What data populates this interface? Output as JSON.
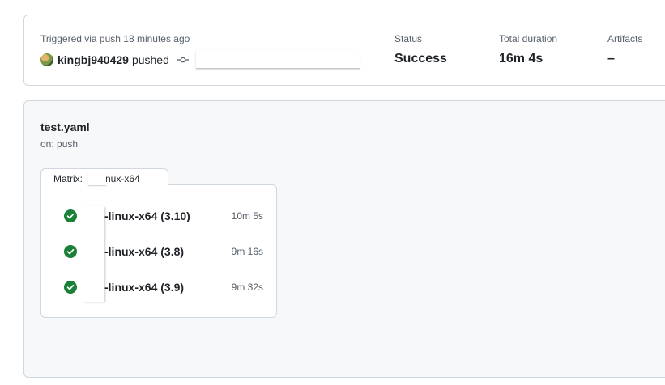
{
  "summary": {
    "trigger_text": "Triggered via push 18 minutes ago",
    "actor": "kingbj940429",
    "action": "pushed",
    "commit_sha": "",
    "status_label": "Status",
    "status_value": "Success",
    "duration_label": "Total duration",
    "duration_value": "16m 4s",
    "artifacts_label": "Artifacts",
    "artifacts_value": "–"
  },
  "workflow": {
    "name": "test.yaml",
    "trigger": "on: push",
    "matrix_label": "Matrix: ",
    "matrix_name_visible": "t-linux-x64",
    "jobs": [
      {
        "name": "-linux-x64 (3.10)",
        "duration": "10m 5s",
        "status": "success"
      },
      {
        "name": "-linux-x64 (3.8)",
        "duration": "9m 16s",
        "status": "success"
      },
      {
        "name": "-linux-x64 (3.9)",
        "duration": "9m 32s",
        "status": "success"
      }
    ]
  },
  "colors": {
    "success": "#1a7f37",
    "border": "#d0d7de",
    "muted": "#57606a"
  }
}
